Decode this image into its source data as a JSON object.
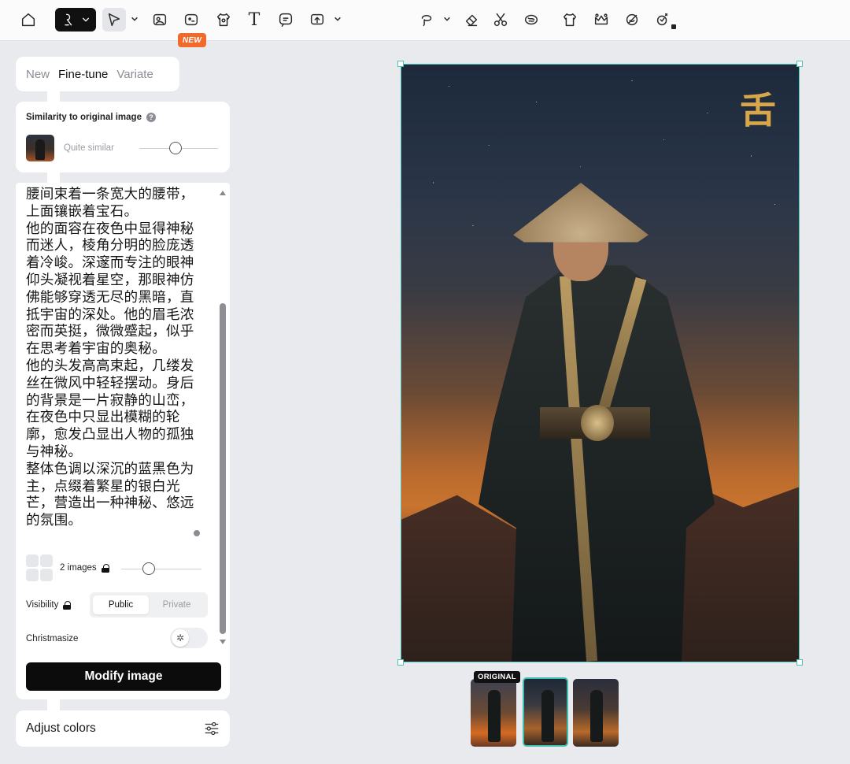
{
  "toolbar": {
    "new_badge": "NEW",
    "text_tool_glyph": "T",
    "icons": [
      "home-icon",
      "character-icon",
      "select-icon",
      "image-icon",
      "face-swap-icon",
      "shirt-icon",
      "text-icon",
      "comment-icon",
      "export-icon",
      "lasso-icon",
      "eraser-icon",
      "scissors-icon",
      "brain-icon",
      "tshirt-icon",
      "crown-icon",
      "sticker-icon",
      "magic-icon"
    ]
  },
  "mode_tabs": [
    {
      "label": "New",
      "active": false
    },
    {
      "label": "Fine-tune",
      "active": true
    },
    {
      "label": "Variate",
      "active": false
    }
  ],
  "similarity": {
    "title": "Similarity to original image",
    "help": "?",
    "value_label": "Quite similar",
    "level": 0.5
  },
  "prompt": {
    "text": "腰间束着一条宽大的腰带，\n上面镶嵌着宝石。\n他的面容在夜色中显得神秘\n而迷人，棱角分明的脸庞透\n着冷峻。深邃而专注的眼神\n仰头凝视着星空，那眼神仿\n佛能够穿透无尽的黑暗，直\n抵宇宙的深处。他的眉毛浓\n密而英挺，微微蹙起，似乎\n在思考着宇宙的奥秘。\n他的头发高高束起，几缕发\n丝在微风中轻轻摆动。身后\n的背景是一片寂静的山峦，\n在夜色中只显出模糊的轮\n廓，愈发凸显出人物的孤独\n与神秘。\n整体色调以深沉的蓝黑色为\n主，点缀着繁星的银白光\n芒，营造出一种神秘、悠远\n的氛围。"
  },
  "image_count": {
    "label": "2 images",
    "level": 0.33
  },
  "visibility": {
    "label": "Visibility",
    "options": [
      "Public",
      "Private"
    ],
    "selected": "Public"
  },
  "christmasize": {
    "label": "Christmasize",
    "enabled": false
  },
  "modify_button": "Modify image",
  "adjust_colors": "Adjust colors",
  "canvas": {
    "seal_text": "舌"
  },
  "thumbnails": {
    "original_tag": "ORIGINAL",
    "selected_index": 1
  },
  "colors": {
    "accent": "#4fc3b5",
    "new_badge": "#f06a2b",
    "primary_button": "#0c0c0c"
  }
}
